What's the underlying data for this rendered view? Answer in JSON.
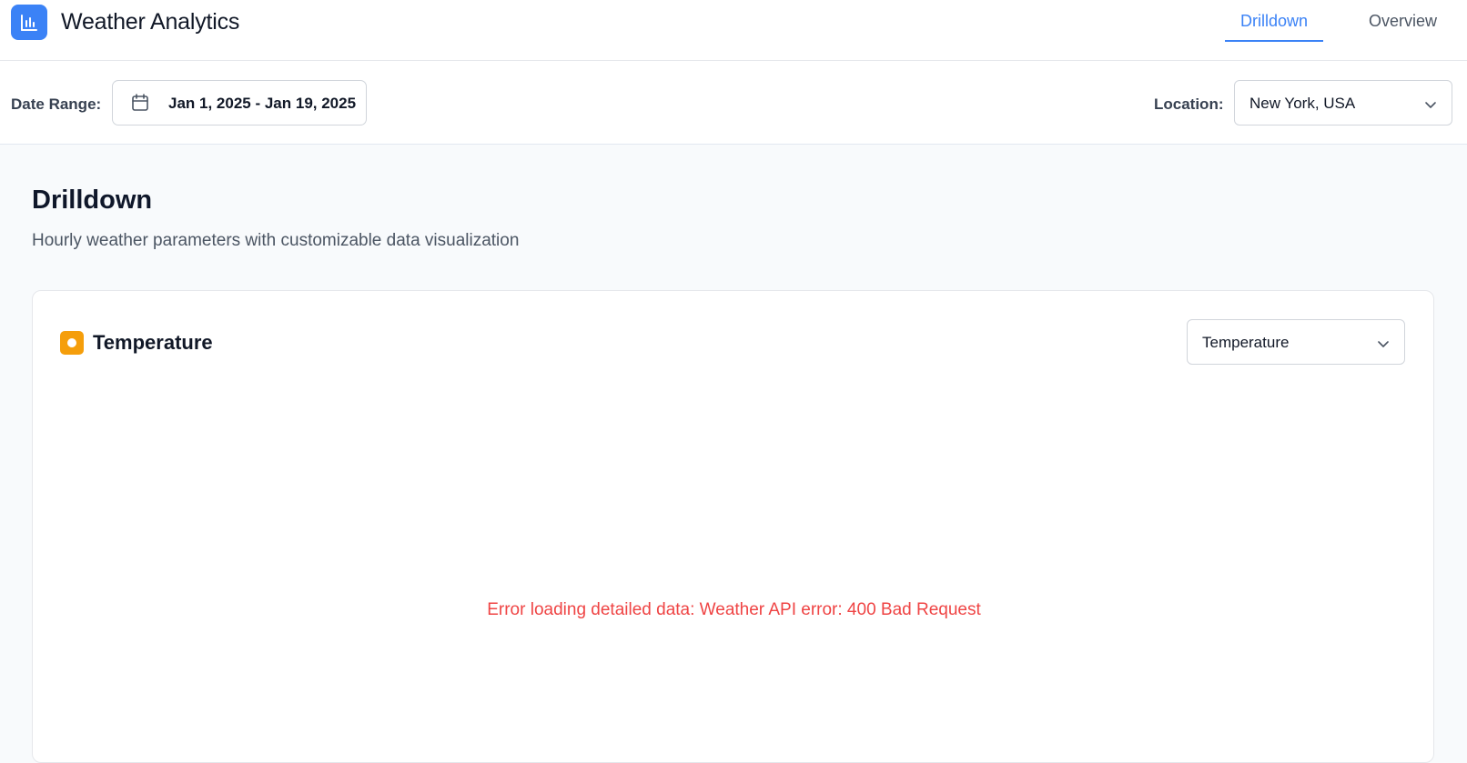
{
  "header": {
    "app_title": "Weather Analytics",
    "logo_icon": "bar-chart-icon",
    "nav": [
      {
        "label": "Drilldown",
        "active": true
      },
      {
        "label": "Overview",
        "active": false
      }
    ]
  },
  "filters": {
    "date_range_label": "Date Range:",
    "date_range_value": "Jan 1, 2025 - Jan 19, 2025",
    "location_label": "Location:",
    "location_value": "New York, USA"
  },
  "main": {
    "title": "Drilldown",
    "subtitle": "Hourly weather parameters with customizable data visualization"
  },
  "card": {
    "title": "Temperature",
    "parameter_select_value": "Temperature",
    "error_message": "Error loading detailed data: Weather API error: 400 Bad Request"
  },
  "colors": {
    "accent": "#3b82f6",
    "temperature_badge": "#f59e0b",
    "error": "#ef4444"
  }
}
